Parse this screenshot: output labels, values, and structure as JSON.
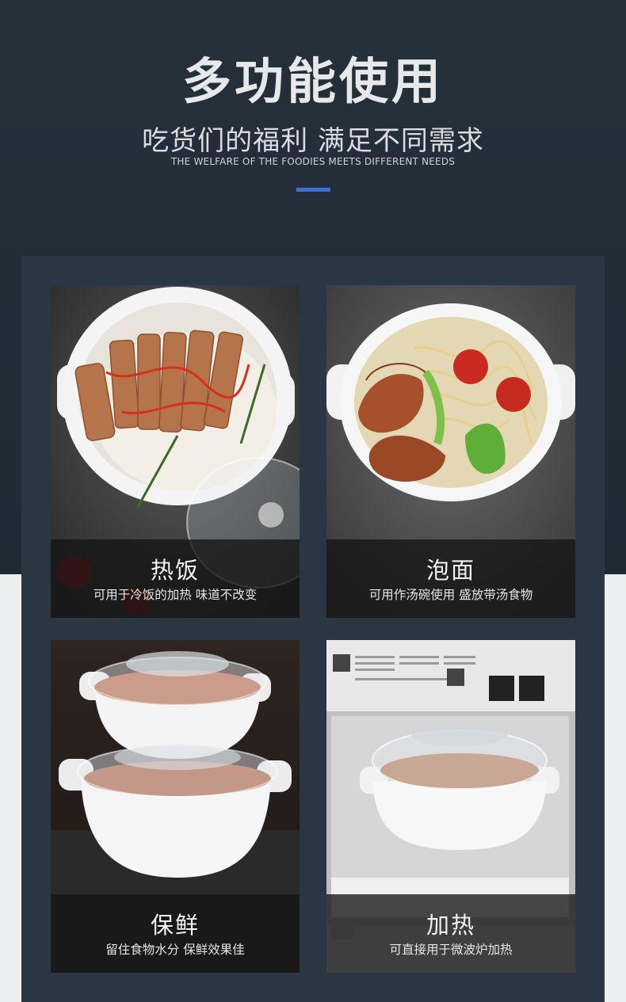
{
  "header": {
    "title": "多功能使用",
    "subtitle": "吃货们的福利 满足不同需求",
    "subtitle_en": "THE WELFARE OF THE FOODIES MEETS DIFFERENT NEEDS"
  },
  "cards": [
    {
      "title": "热饭",
      "desc": "可用于冷饭的加热 味道不改变"
    },
    {
      "title": "泡面",
      "desc": "可用作汤碗使用 盛放带汤食物"
    },
    {
      "title": "保鲜",
      "desc": "留住食物水分 保鲜效果佳"
    },
    {
      "title": "加热",
      "desc": "可直接用于微波炉加热"
    }
  ],
  "colors": {
    "background_dark": "#25303b",
    "panel": "#2a3642",
    "accent": "#3e6fd6"
  }
}
